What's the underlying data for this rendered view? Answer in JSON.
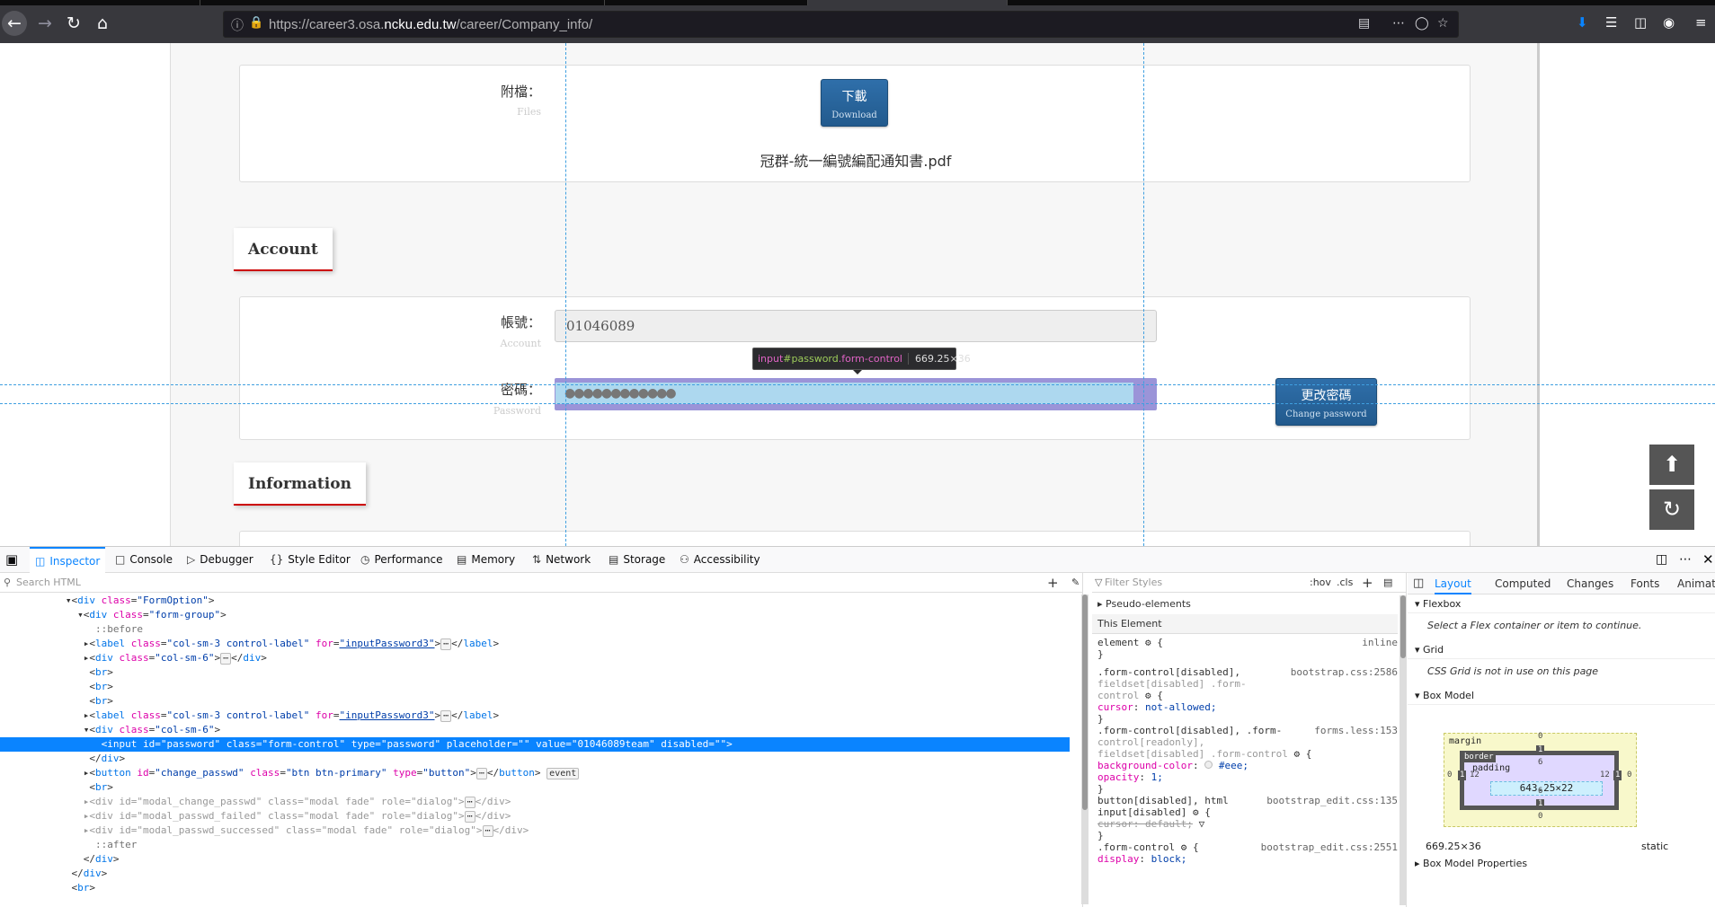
{
  "browser": {
    "url_prefix": "https://career3.osa.",
    "url_domain": "ncku.edu.tw",
    "url_path": "/career/Company_info/"
  },
  "page": {
    "files_label_zh": "附檔：",
    "files_label_en": "Files",
    "download_btn_zh": "下載",
    "download_btn_en": "Download",
    "file_name": "冠群-統一編號編配通知書.pdf",
    "account_section_title": "Account",
    "account_label_zh": "帳號：",
    "account_label_en": "Account",
    "account_value": "01046089",
    "password_label_zh": "密碼：",
    "password_label_en": "Password",
    "password_mask": "●●●●●●●●●●●●",
    "change_pw_btn_zh": "更改密碼",
    "change_pw_btn_en": "Change password",
    "information_section_title": "Information",
    "tooltip_tag": "input",
    "tooltip_id": "#password",
    "tooltip_class": ".form-control",
    "tooltip_dims": "669.25×36"
  },
  "devtools": {
    "tabs": [
      "Inspector",
      "Console",
      "Debugger",
      "Style Editor",
      "Performance",
      "Memory",
      "Network",
      "Storage",
      "Accessibility"
    ],
    "search_placeholder": "Search HTML",
    "filter_placeholder": "Filter Styles",
    "hov_label": ":hov",
    "cls_label": ".cls",
    "pseudo_elements": "Pseudo-elements",
    "this_element": "This Element",
    "rules": {
      "r1_sel": "element",
      "r1_src": "inline",
      "r2_sel_a": ".form-control[disabled],",
      "r2_sel_b": "fieldset[disabled] .form-",
      "r2_sel_c": "control",
      "r2_src": "bootstrap.css:2586",
      "r2_prop": "cursor",
      "r2_val": "not-allowed;",
      "r3_sel_a": ".form-control[disabled], .form-",
      "r3_sel_b": "control[readonly],",
      "r3_sel_c": "fieldset[disabled] .form-control",
      "r3_src": "forms.less:153",
      "r3_prop1": "background-color",
      "r3_val1": "#eee;",
      "r3_prop2": "opacity",
      "r3_val2": "1;",
      "r4_sel_a": "button[disabled], html",
      "r4_sel_b": "input[disabled]",
      "r4_src": "bootstrap_edit.css:135",
      "r4_prop": "cursor: default;",
      "r5_sel": ".form-control",
      "r5_src": "bootstrap_edit.css:2551",
      "r5_prop": "display",
      "r5_val": "block;"
    },
    "layout_tabs": [
      "Layout",
      "Computed",
      "Changes",
      "Fonts",
      "Animat"
    ],
    "flexbox_title": "Flexbox",
    "flexbox_note": "Select a Flex container or item to continue.",
    "grid_title": "Grid",
    "grid_note": "CSS Grid is not in use on this page",
    "box_model_title": "Box Model",
    "bm_margin": "margin",
    "bm_border": "border",
    "bm_padding": "padding",
    "bm_content": "643.25×22",
    "bm_margin_top": "0",
    "bm_margin_bottom": "0",
    "bm_margin_left": "0",
    "bm_margin_right": "0",
    "bm_border_top": "1",
    "bm_border_bottom": "1",
    "bm_border_left": "1",
    "bm_border_right": "1",
    "bm_padding_top": "6",
    "bm_padding_bottom": "6",
    "bm_padding_left": "12",
    "bm_padding_right": "12",
    "bm_size": "669.25×36",
    "bm_position": "static",
    "bm_props_title": "Box Model Properties"
  }
}
